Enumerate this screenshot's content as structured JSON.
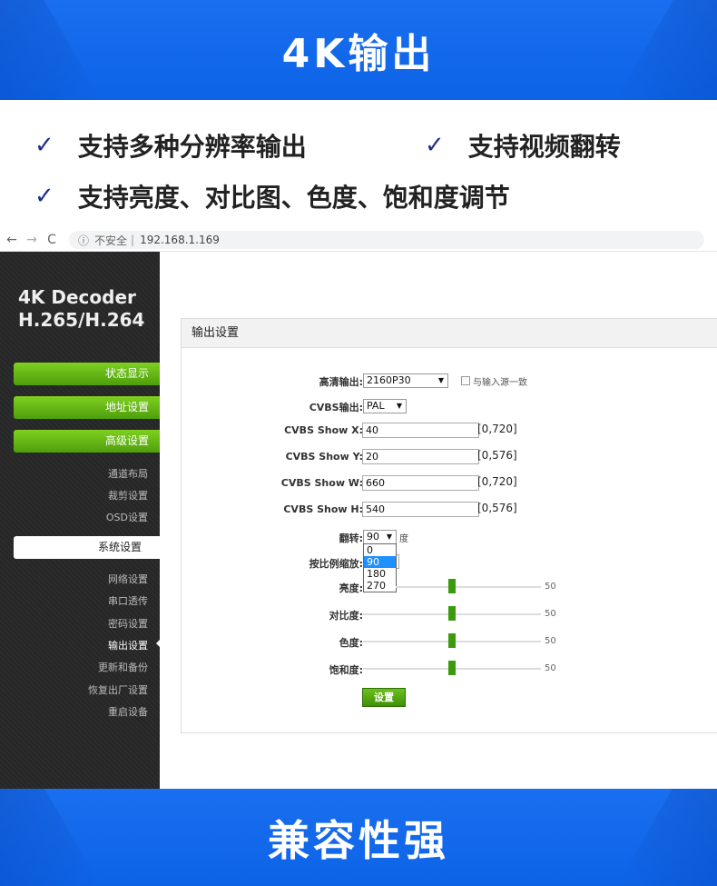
{
  "top_banner": {
    "title": "4K输出"
  },
  "features": [
    {
      "text": "支持多种分辨率输出"
    },
    {
      "text": "支持视频翻转"
    },
    {
      "text": "支持亮度、对比图、色度、饱和度调节"
    }
  ],
  "check_glyph": "✓",
  "browser": {
    "back": "←",
    "forward": "→",
    "reload": "C",
    "info_icon": "ⓘ",
    "security_label": "不安全",
    "separator": "|",
    "url": "192.168.1.169"
  },
  "sidebar": {
    "brand_line1": "4K Decoder",
    "brand_line2": "H.265/H.264",
    "main_buttons": [
      "状态显示",
      "地址设置",
      "高级设置"
    ],
    "advanced_sub": [
      "通道布局",
      "裁剪设置",
      "OSD设置"
    ],
    "system_button": "系统设置",
    "system_sub": [
      "网络设置",
      "串口透传",
      "密码设置",
      "输出设置",
      "更新和备份",
      "恢复出厂设置",
      "重启设备"
    ],
    "active_item": "输出设置"
  },
  "panel": {
    "title": "输出设置",
    "hd_output": {
      "label": "高清输出:",
      "value": "2160P30",
      "checkbox_label": "与输入源一致",
      "checked": false
    },
    "cvbs_output": {
      "label": "CVBS输出:",
      "value": "PAL"
    },
    "cvbs_x": {
      "label": "CVBS Show X:",
      "value": "40",
      "range": "[0,720]"
    },
    "cvbs_y": {
      "label": "CVBS Show Y:",
      "value": "20",
      "range": "[0,576]"
    },
    "cvbs_w": {
      "label": "CVBS Show W:",
      "value": "660",
      "range": "[0,720]"
    },
    "cvbs_h": {
      "label": "CVBS Show H:",
      "value": "540",
      "range": "[0,576]"
    },
    "flip": {
      "label": "翻转:",
      "value": "90",
      "unit": "度",
      "options": [
        "0",
        "90",
        "180",
        "270"
      ],
      "highlighted": "90"
    },
    "scale": {
      "label": "按比例缩放:"
    },
    "brightness": {
      "label": "亮度:",
      "value": "50"
    },
    "contrast": {
      "label": "对比度:",
      "value": "50"
    },
    "hue": {
      "label": "色度:",
      "value": "50"
    },
    "saturation": {
      "label": "饱和度:",
      "value": "50"
    },
    "submit_label": "设置"
  },
  "bottom_banner": {
    "title": "兼容性强"
  }
}
